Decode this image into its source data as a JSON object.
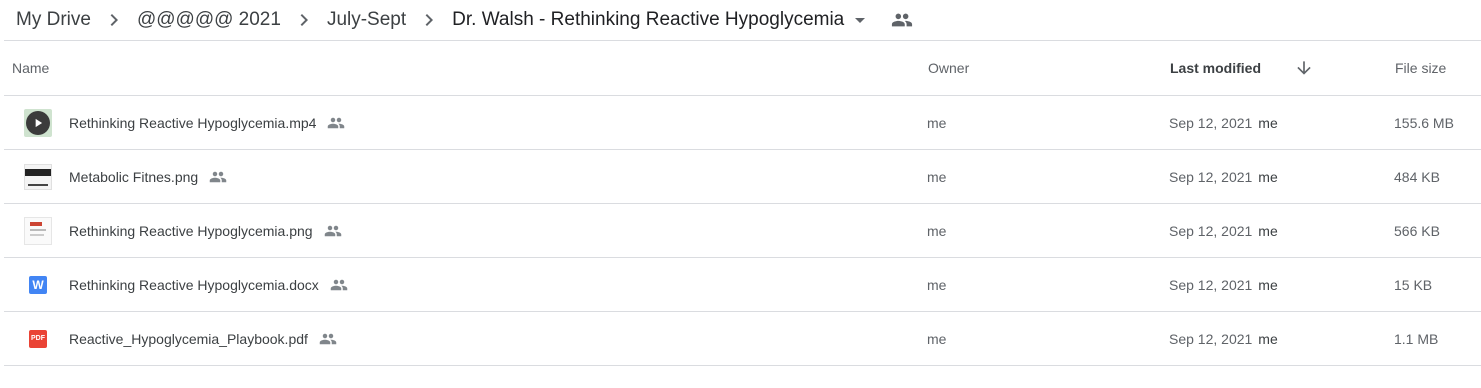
{
  "breadcrumb": {
    "items": [
      "My Drive",
      "@@@@@ 2021",
      "July-Sept",
      "Dr. Walsh - Rethinking Reactive Hypoglycemia"
    ]
  },
  "table": {
    "headers": {
      "name": "Name",
      "owner": "Owner",
      "modified": "Last modified",
      "size": "File size"
    },
    "rows": [
      {
        "name": "Rethinking Reactive Hypoglycemia.mp4",
        "icon": "video-thumbnail-icon",
        "owner": "me",
        "modified": "Sep 12, 2021",
        "modified_by": "me",
        "size": "155.6 MB"
      },
      {
        "name": "Metabolic Fitnes.png",
        "icon": "image-thumbnail-icon",
        "owner": "me",
        "modified": "Sep 12, 2021",
        "modified_by": "me",
        "size": "484 KB"
      },
      {
        "name": "Rethinking Reactive Hypoglycemia.png",
        "icon": "image-thumbnail-icon",
        "owner": "me",
        "modified": "Sep 12, 2021",
        "modified_by": "me",
        "size": "566 KB"
      },
      {
        "name": "Rethinking Reactive Hypoglycemia.docx",
        "icon": "word-doc-icon",
        "icon_label": "W",
        "owner": "me",
        "modified": "Sep 12, 2021",
        "modified_by": "me",
        "size": "15 KB"
      },
      {
        "name": "Reactive_Hypoglycemia_Playbook.pdf",
        "icon": "pdf-icon",
        "icon_label": "PDF",
        "owner": "me",
        "modified": "Sep 12, 2021",
        "modified_by": "me",
        "size": "1.1 MB"
      }
    ]
  },
  "colors": {
    "text": "#3c4043",
    "secondary": "#5f6368",
    "divider": "#dadce0",
    "word_blue": "#4285f4",
    "pdf_red": "#ea4335"
  }
}
